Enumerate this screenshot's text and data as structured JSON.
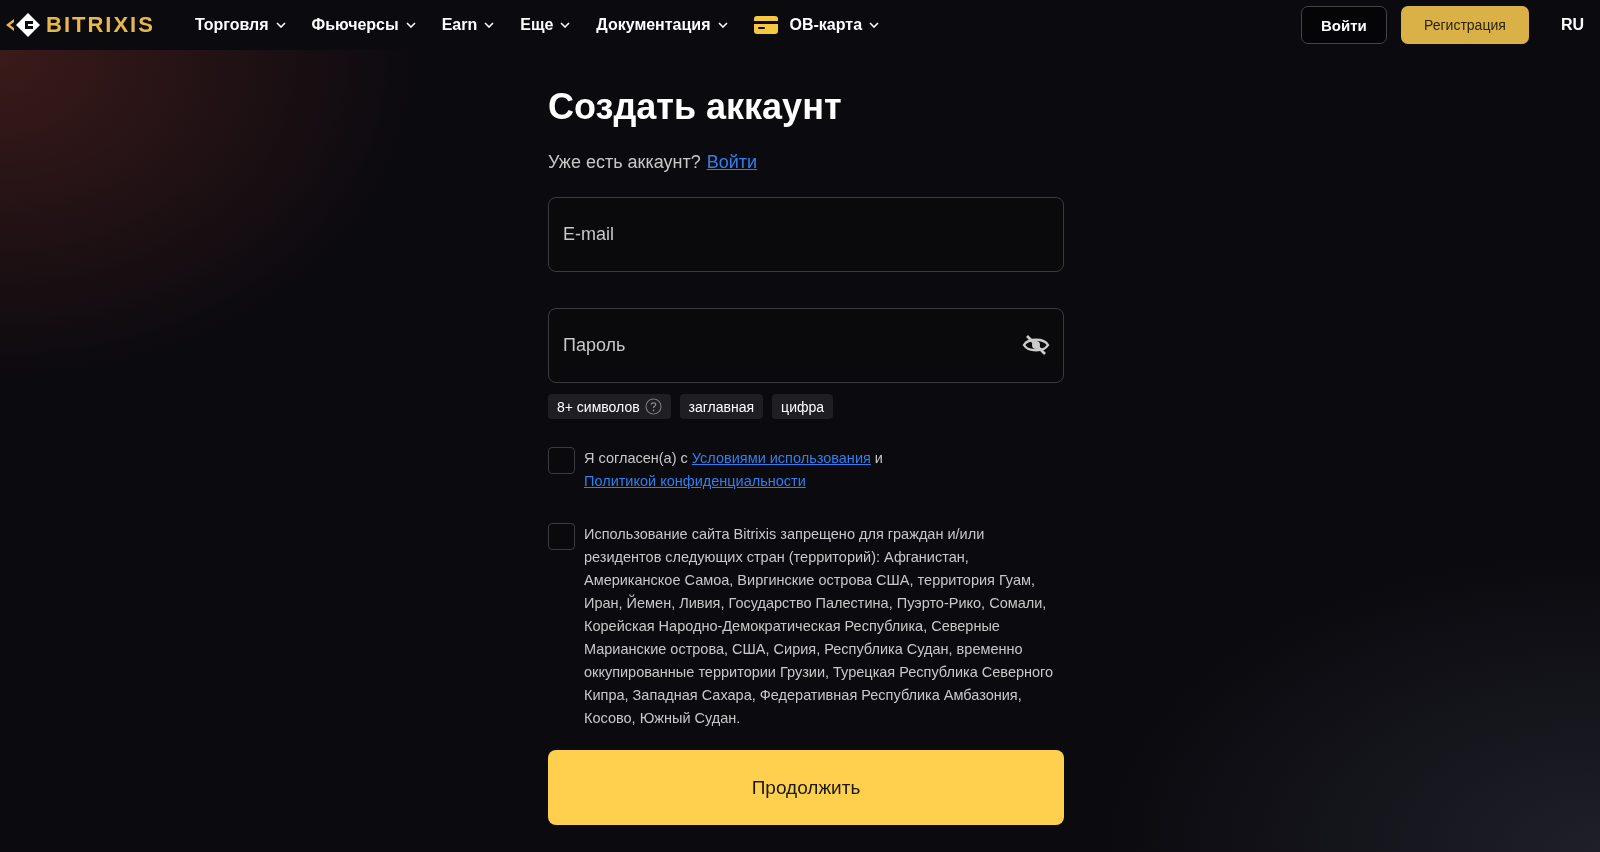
{
  "header": {
    "logo": "BITRIXIS",
    "nav": [
      {
        "label": "Торговля",
        "kind": "menu"
      },
      {
        "label": "Фьючерсы",
        "kind": "menu"
      },
      {
        "label": "Earn",
        "kind": "menu"
      },
      {
        "label": "Еще",
        "kind": "menu"
      },
      {
        "label": "Документация",
        "kind": "menu"
      },
      {
        "label": "OB-карта",
        "kind": "card"
      }
    ],
    "login": "Войти",
    "register": "Регистрация",
    "language": "RU"
  },
  "form": {
    "title": "Создать аккаунт",
    "have_account": "Уже есть аккаунт?",
    "login_link": "Войти",
    "email": {
      "placeholder": "E-mail"
    },
    "password": {
      "placeholder": "Пароль"
    },
    "requirements": [
      {
        "label": "8+ символов",
        "help": true
      },
      {
        "label": "заглавная",
        "help": false
      },
      {
        "label": "цифра",
        "help": false
      }
    ],
    "terms": {
      "checked": false,
      "prefix": "Я согласен(а) с",
      "link1": "Условиями использования",
      "middle": "и",
      "link2": "Политикой конфиденциальности"
    },
    "restriction": {
      "checked": false,
      "text": "Использование сайта Bitrixis запрещено для граждан и/или резидентов следующих стран (территорий): Афганистан, Американское Самоа, Виргинские острова США, территория Гуам, Иран, Йемен, Ливия, Государство Палестина, Пуэрто-Рико, Сомали, Корейская Народно-Демократическая Республика, Северные Марианские острова, США, Сирия, Республика Судан, временно оккупированные территории Грузии, Турецкая Республика Северного Кипра, Западная Сахара, Федеративная Республика Амбазония, Косово, Южный Судан."
    },
    "submit": "Продолжить"
  }
}
